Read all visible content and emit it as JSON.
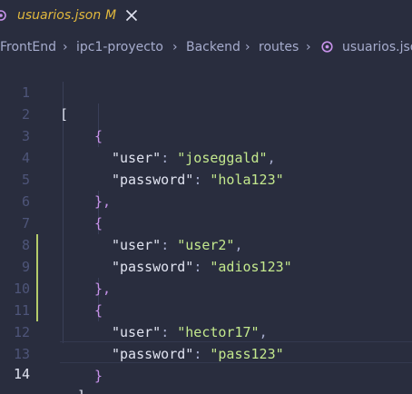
{
  "tab": {
    "title": "usuarios.json",
    "badge": "M",
    "title_color": "#e2b93d",
    "icon": "json-braces-icon",
    "close_icon": "close-icon"
  },
  "breadcrumb": {
    "items": [
      "FrontEnd",
      "ipc1-proyecto",
      "Backend",
      "routes",
      "usuarios.json"
    ],
    "file_icon": "json-braces-icon"
  },
  "editor": {
    "current_line": 14,
    "lines": [
      {
        "n": "1",
        "text": "["
      },
      {
        "n": "2",
        "text": "{"
      },
      {
        "n": "3",
        "key": "\"user\"",
        "value": "\"joseggald\"",
        "comma": ","
      },
      {
        "n": "4",
        "key": "\"password\"",
        "value": "\"hola123\"",
        "comma": ""
      },
      {
        "n": "5",
        "text": "},"
      },
      {
        "n": "6",
        "text": "{"
      },
      {
        "n": "7",
        "key": "\"user\"",
        "value": "\"user2\"",
        "comma": ","
      },
      {
        "n": "8",
        "key": "\"password\"",
        "value": "\"adios123\"",
        "comma": ""
      },
      {
        "n": "9",
        "text": "},"
      },
      {
        "n": "10",
        "text": "{"
      },
      {
        "n": "11",
        "key": "\"user\"",
        "value": "\"hector17\"",
        "comma": ","
      },
      {
        "n": "12",
        "key": "\"password\"",
        "value": "\"pass123\"",
        "comma": ""
      },
      {
        "n": "13",
        "text": "}"
      },
      {
        "n": "14",
        "text": "]"
      }
    ]
  },
  "colors": {
    "background": "#292d3e",
    "string": "#c3e88d",
    "key": "#e0e3f0",
    "brace": "#c792ea",
    "modified_gutter": "#b5cc6a",
    "line_number": "#4e5579"
  }
}
